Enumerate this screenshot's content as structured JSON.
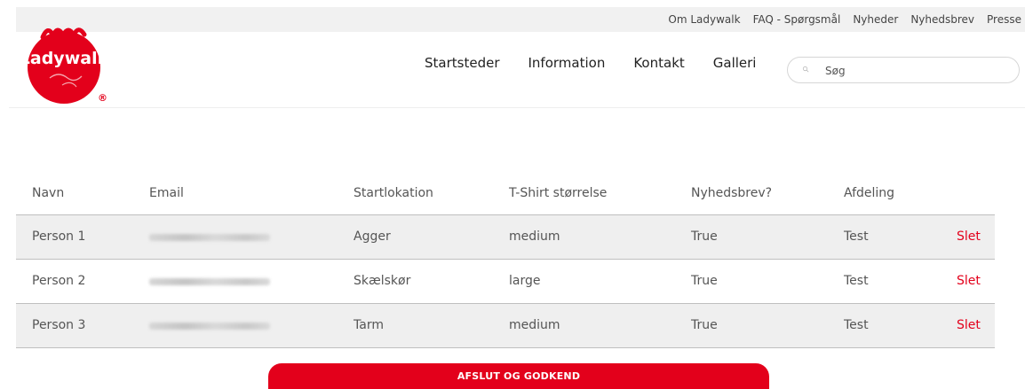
{
  "header": {
    "top_links": [
      "Om Ladywalk",
      "FAQ - Spørgsmål",
      "Nyheder",
      "Nyhedsbrev",
      "Presse"
    ],
    "logo_text": "Ladywalk",
    "logo_mark": "®",
    "nav": [
      "Startsteder",
      "Information",
      "Kontakt",
      "Galleri"
    ],
    "search": {
      "placeholder": "Søg",
      "icon": "search-icon"
    }
  },
  "table": {
    "columns": [
      "Navn",
      "Email",
      "Startlokation",
      "T-Shirt størrelse",
      "Nyhedsbrev?",
      "Afdeling"
    ],
    "rows": [
      {
        "name": "Person 1",
        "location": "Agger",
        "size": "medium",
        "newsletter": "True",
        "department": "Test",
        "delete_label": "Slet"
      },
      {
        "name": "Person 2",
        "location": "Skælskør",
        "size": "large",
        "newsletter": "True",
        "department": "Test",
        "delete_label": "Slet"
      },
      {
        "name": "Person 3",
        "location": "Tarm",
        "size": "medium",
        "newsletter": "True",
        "department": "Test",
        "delete_label": "Slet"
      }
    ]
  },
  "finish_button": {
    "label": "AFSLUT OG GODKEND"
  },
  "colors": {
    "brand_red": "#e3001b",
    "row_shade": "#efefef",
    "top_bar": "#f1f1f1"
  }
}
